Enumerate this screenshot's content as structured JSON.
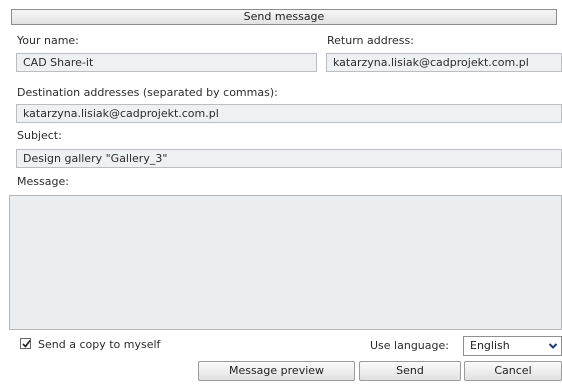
{
  "window": {
    "title": "Send message"
  },
  "form": {
    "your_name_label": "Your name:",
    "your_name_value": "CAD Share-it",
    "return_address_label": "Return address:",
    "return_address_value": "katarzyna.lisiak@cadprojekt.com.pl",
    "destination_label": "Destination addresses (separated by commas):",
    "destination_value": "katarzyna.lisiak@cadprojekt.com.pl",
    "subject_label": "Subject:",
    "subject_value": "Design gallery \"Gallery_3\"",
    "message_label": "Message:",
    "message_value": ""
  },
  "footer": {
    "copy_label": "Send a copy to myself",
    "copy_checked": true,
    "language_label": "Use language:",
    "language_value": "English",
    "preview_button": "Message preview",
    "send_button": "Send",
    "cancel_button": "Cancel"
  },
  "icons": {
    "checkbox": "checkmark-icon",
    "dropdown": "chevron-down-icon"
  }
}
